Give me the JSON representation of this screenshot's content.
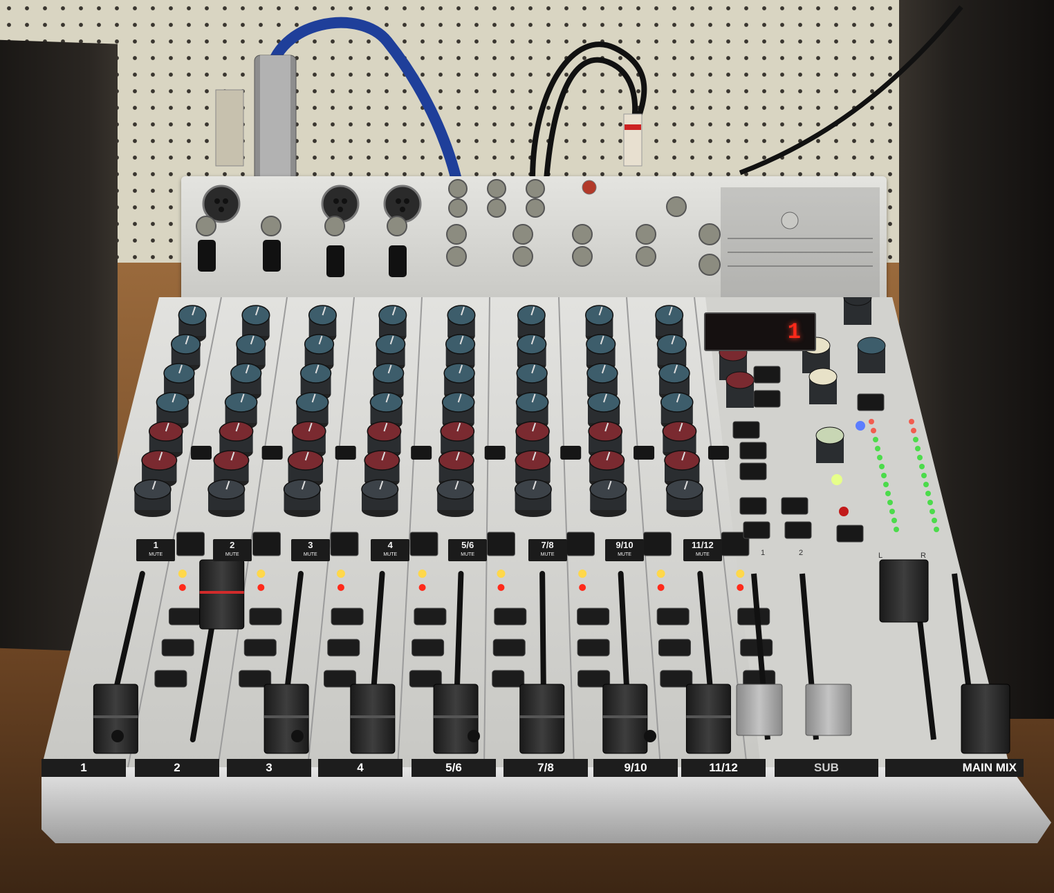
{
  "channels": [
    {
      "strip_label": "1",
      "mute_num": "1"
    },
    {
      "strip_label": "2",
      "mute_num": "2"
    },
    {
      "strip_label": "3",
      "mute_num": "3"
    },
    {
      "strip_label": "4",
      "mute_num": "4"
    },
    {
      "strip_label": "5/6",
      "mute_num": "5/6"
    },
    {
      "strip_label": "7/8",
      "mute_num": "7/8"
    },
    {
      "strip_label": "9/10",
      "mute_num": "9/10"
    },
    {
      "strip_label": "11/12",
      "mute_num": "11/12"
    }
  ],
  "mute_text": "MUTE",
  "sub_label": "SUB",
  "main_mix_label": "MAIN MIX",
  "display_value": "1",
  "sub_buttons": [
    "1",
    "2"
  ],
  "meter_lr": [
    "L",
    "R"
  ],
  "colors": {
    "knob_blue": "#3d5d6b",
    "knob_red": "#7a2a30",
    "knob_gray": "#3c4248",
    "panel": "#d8d8d4",
    "led_yellow": "#ffd84a",
    "led_green": "#3ddc3d",
    "led_red": "#ff2a1a",
    "cable_blue": "#1f3f9a"
  }
}
